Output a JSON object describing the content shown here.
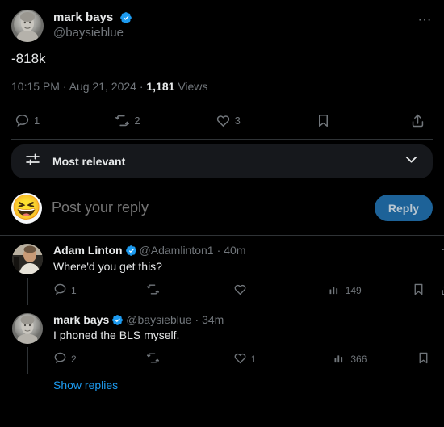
{
  "post": {
    "author_name": "mark bays",
    "author_handle": "@baysieblue",
    "verified_icon": "verified-badge-icon",
    "more_icon": "more-options-icon",
    "text": "-818k",
    "time": "10:15 PM",
    "date": "Aug 21, 2024",
    "views_count": "1,181",
    "views_label": "Views",
    "meta_sep": "·"
  },
  "engagement": {
    "reply": {
      "icon": "reply-icon",
      "count": "1"
    },
    "repost": {
      "icon": "repost-icon",
      "count": "2"
    },
    "like": {
      "icon": "like-icon",
      "count": "3"
    },
    "bookmark": {
      "icon": "bookmark-icon",
      "count": ""
    },
    "share": {
      "icon": "share-icon",
      "count": ""
    }
  },
  "filter": {
    "icon": "sort-filter-icon",
    "label": "Most relevant",
    "chevron_icon": "chevron-down-icon"
  },
  "composer": {
    "avatar_emoji": "😆",
    "placeholder": "Post your reply",
    "value": "",
    "reply_button": "Reply"
  },
  "replies": [
    {
      "name": "Adam Linton",
      "handle": "@Adamlinton1",
      "separator": "·",
      "time": "40m",
      "text": "Where'd you get this?",
      "verified": true,
      "actions": {
        "reply_count": "1",
        "repost_count": "",
        "like_count": "",
        "views_count": "149"
      }
    },
    {
      "name": "mark bays",
      "handle": "@baysieblue",
      "separator": "·",
      "time": "34m",
      "text": "I phoned the BLS myself.",
      "verified": true,
      "actions": {
        "reply_count": "2",
        "repost_count": "",
        "like_count": "1",
        "views_count": "366"
      }
    }
  ],
  "show_replies_label": "Show replies",
  "colors": {
    "background": "#000000",
    "text_primary": "#e7e9ea",
    "text_secondary": "#71767b",
    "link": "#1d9bf0",
    "verified_blue": "#1d9bf0",
    "reply_button": "#1d6298",
    "divider": "#2f3336",
    "pill_background": "#16181c"
  }
}
